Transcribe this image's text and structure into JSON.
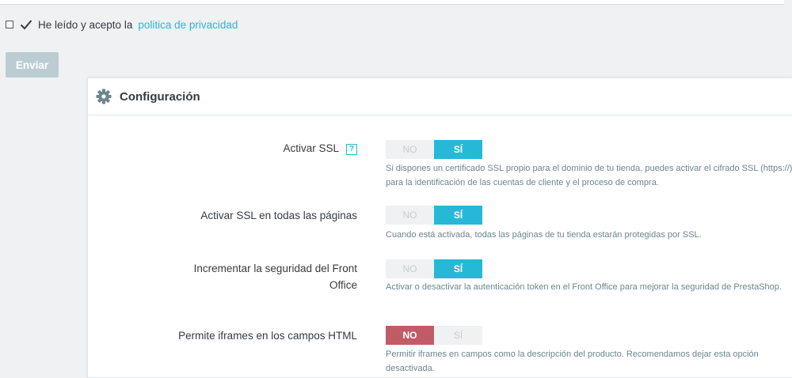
{
  "consent": {
    "label": "He leído y acepto la",
    "link": "politica de privacidad"
  },
  "submit": {
    "label": "Enviar"
  },
  "panel": {
    "title": "Configuración",
    "icon": "gear-icon",
    "help_icon_glyph": "?"
  },
  "options": [
    {
      "label": "Activar SSL",
      "no": "NO",
      "yes": "SÍ",
      "value": "yes",
      "help": "Si dispones un certificado SSL propio para el dominio de tu tienda, puedes activar el cifrado SSL (https://) para la identificación de las cuentas de cliente y el proceso de compra."
    },
    {
      "label": "Activar SSL en todas las páginas",
      "no": "NO",
      "yes": "SÍ",
      "value": "yes",
      "help": "Cuando está activada, todas las páginas de tu tienda estarán protegidas por SSL."
    },
    {
      "label": "Incrementar la seguridad del Front Office",
      "no": "NO",
      "yes": "SÍ",
      "value": "yes",
      "help": "Activar o desactivar la autenticación token en el Front Office para mejorar la seguridad de PrestaShop."
    },
    {
      "label": "Permite iframes en los campos HTML",
      "no": "NO",
      "yes": "SÍ",
      "value": "no",
      "help": "Permitir iframes en campos como la descripción del producto. Recomendamos dejar esta opción desactivada."
    }
  ],
  "colors": {
    "accent": "#25b9d7",
    "danger": "#c05c67",
    "button_disabled": "#bbcdd2"
  }
}
